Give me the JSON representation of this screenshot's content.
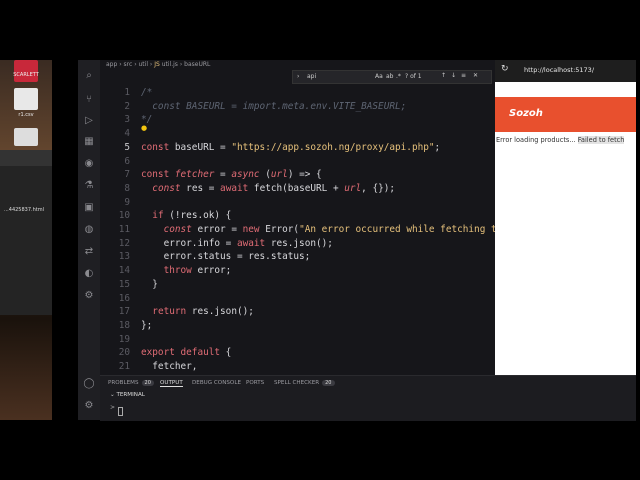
{
  "desktop": {
    "icons": [
      {
        "label": "SCARLETT"
      },
      {
        "label": "r1.csv"
      }
    ],
    "finder_file": "...4425837.html"
  },
  "editor": {
    "breadcrumb": [
      "app",
      "src",
      "util",
      "util.js",
      "baseURL"
    ],
    "find": {
      "query": "api",
      "match_count": "? of 1",
      "case_label": "Aa",
      "word_label": "ab",
      "regex_label": ".*"
    },
    "lines": [
      {
        "n": "1",
        "html": "<span class='cm'>/*</span>"
      },
      {
        "n": "2",
        "html": "<span class='cm'>  const BASEURL = import.meta.env.VITE_BASEURL;</span>"
      },
      {
        "n": "3",
        "html": "<span class='cm'>*/</span>"
      },
      {
        "n": "4",
        "html": ""
      },
      {
        "n": "5",
        "html": "<span class='kw'>const</span> baseURL = <span class='str'>\"https://app.sozoh.ng/proxy/api.php\"</span>;"
      },
      {
        "n": "6",
        "html": ""
      },
      {
        "n": "7",
        "html": "<span class='kw'>const</span> <span class='it'>fetcher</span> = <span class='it'>async</span> (<span class='it'>url</span>) =&gt; {"
      },
      {
        "n": "8",
        "html": "  <span class='it'>const</span> res = <span class='kw'>await</span> fetch(baseURL + <span class='it'>url</span>, {});"
      },
      {
        "n": "9",
        "html": ""
      },
      {
        "n": "10",
        "html": "  <span class='kw'>if</span> (!res.ok) {"
      },
      {
        "n": "11",
        "html": "    <span class='it'>const</span> error = <span class='kw'>new</span> Error(<span class='str'>\"An error occurred while fetching the</span>"
      },
      {
        "n": "12",
        "html": "    error.info = <span class='kw'>await</span> res.json();"
      },
      {
        "n": "13",
        "html": "    error.status = res.status;"
      },
      {
        "n": "14",
        "html": "    <span class='kw'>throw</span> error;"
      },
      {
        "n": "15",
        "html": "  }"
      },
      {
        "n": "16",
        "html": ""
      },
      {
        "n": "17",
        "html": "  <span class='kw'>return</span> res.json();"
      },
      {
        "n": "18",
        "html": "};"
      },
      {
        "n": "19",
        "html": ""
      },
      {
        "n": "20",
        "html": "<span class='kw'>export default</span> {"
      },
      {
        "n": "21",
        "html": "  fetcher,"
      }
    ]
  },
  "panel": {
    "tabs": [
      {
        "label": "PROBLEMS",
        "badge": "20"
      },
      {
        "label": "OUTPUT",
        "badge": ""
      },
      {
        "label": "DEBUG CONSOLE",
        "badge": ""
      },
      {
        "label": "PORTS",
        "badge": ""
      },
      {
        "label": "SPELL CHECKER",
        "badge": "20"
      }
    ],
    "terminal_label": "TERMINAL"
  },
  "browser": {
    "url": "http://localhost:5173/",
    "logo": "Sozoh",
    "error_prefix": "Error loading products...",
    "error_highlight": "Failed to fetch"
  },
  "colors": {
    "accent": "#e8502e",
    "editor_bg": "#16161a"
  }
}
